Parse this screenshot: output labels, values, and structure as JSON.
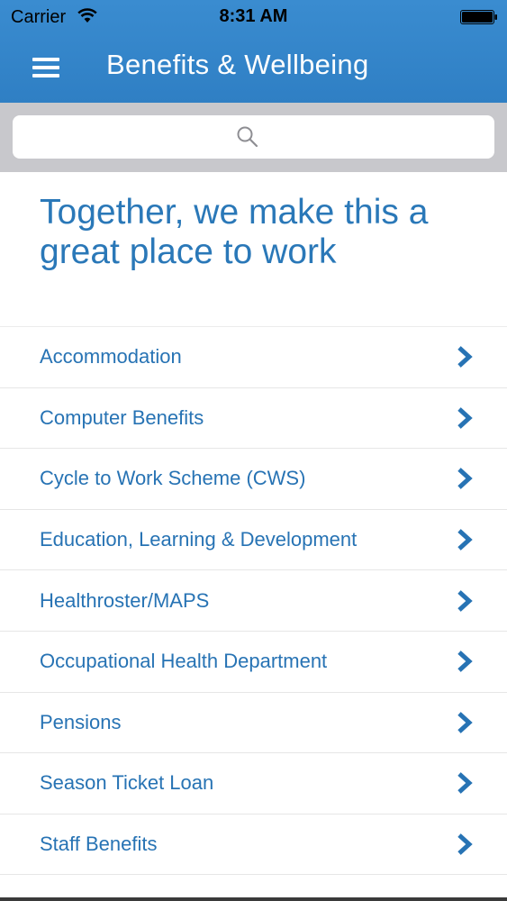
{
  "status_bar": {
    "carrier": "Carrier",
    "time": "8:31 AM",
    "wifi_icon": "wifi-icon",
    "battery_icon": "battery-icon"
  },
  "header": {
    "title": "Benefits & Wellbeing",
    "menu_icon": "hamburger-menu-icon",
    "background_color": "#2f7fc4"
  },
  "search": {
    "placeholder": "",
    "icon": "search-icon"
  },
  "main": {
    "tagline": "Together, we make this a great place to work",
    "accent_color": "#2773b4",
    "items": [
      {
        "label": "Accommodation",
        "icon": "chevron-right-icon"
      },
      {
        "label": "Computer Benefits",
        "icon": "chevron-right-icon"
      },
      {
        "label": "Cycle to Work Scheme (CWS)",
        "icon": "chevron-right-icon"
      },
      {
        "label": "Education, Learning & Development",
        "icon": "chevron-right-icon"
      },
      {
        "label": "Healthroster/MAPS",
        "icon": "chevron-right-icon"
      },
      {
        "label": "Occupational Health Department",
        "icon": "chevron-right-icon"
      },
      {
        "label": "Pensions",
        "icon": "chevron-right-icon"
      },
      {
        "label": "Season Ticket Loan",
        "icon": "chevron-right-icon"
      },
      {
        "label": "Staff Benefits",
        "icon": "chevron-right-icon"
      }
    ]
  }
}
